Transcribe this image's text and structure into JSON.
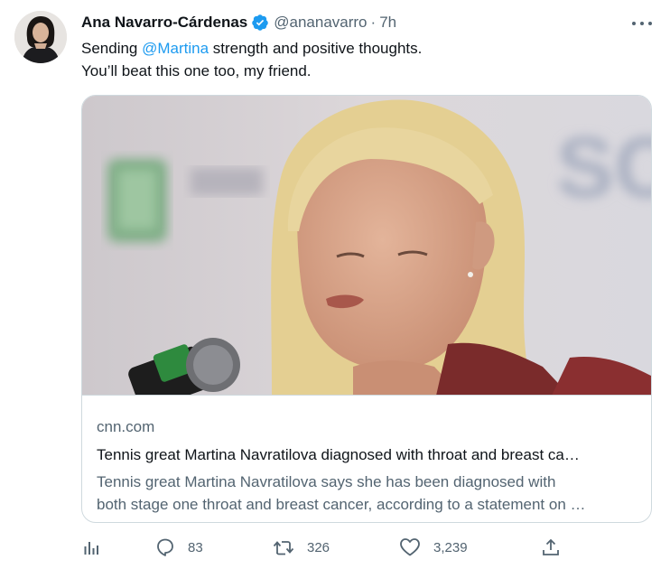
{
  "author": {
    "name": "Ana Navarro-Cárdenas",
    "handle": "@ananavarro",
    "separator": "·",
    "time": "7h",
    "verified": true
  },
  "tweet": {
    "line1_before": "Sending ",
    "mention": "@Martina",
    "line1_after": " strength and positive thoughts.",
    "line2": "You’ll beat this one too, my friend."
  },
  "card": {
    "domain": "cnn.com",
    "title": "Tennis great Martina Navratilova diagnosed with throat and breast ca…",
    "description_line1": "Tennis great Martina Navratilova says she has been diagnosed with",
    "description_line2": "both stage one throat and breast cancer, according to a statement on …"
  },
  "actions": {
    "analytics": {
      "icon": "analytics-icon"
    },
    "reply": {
      "icon": "reply-icon",
      "count": "83"
    },
    "retweet": {
      "icon": "retweet-icon",
      "count": "326"
    },
    "like": {
      "icon": "heart-icon",
      "count": "3,239"
    },
    "share": {
      "icon": "share-icon"
    }
  },
  "colors": {
    "text": "#0f1419",
    "secondary": "#536471",
    "accent": "#1d9bf0",
    "border": "#cfd9de"
  }
}
